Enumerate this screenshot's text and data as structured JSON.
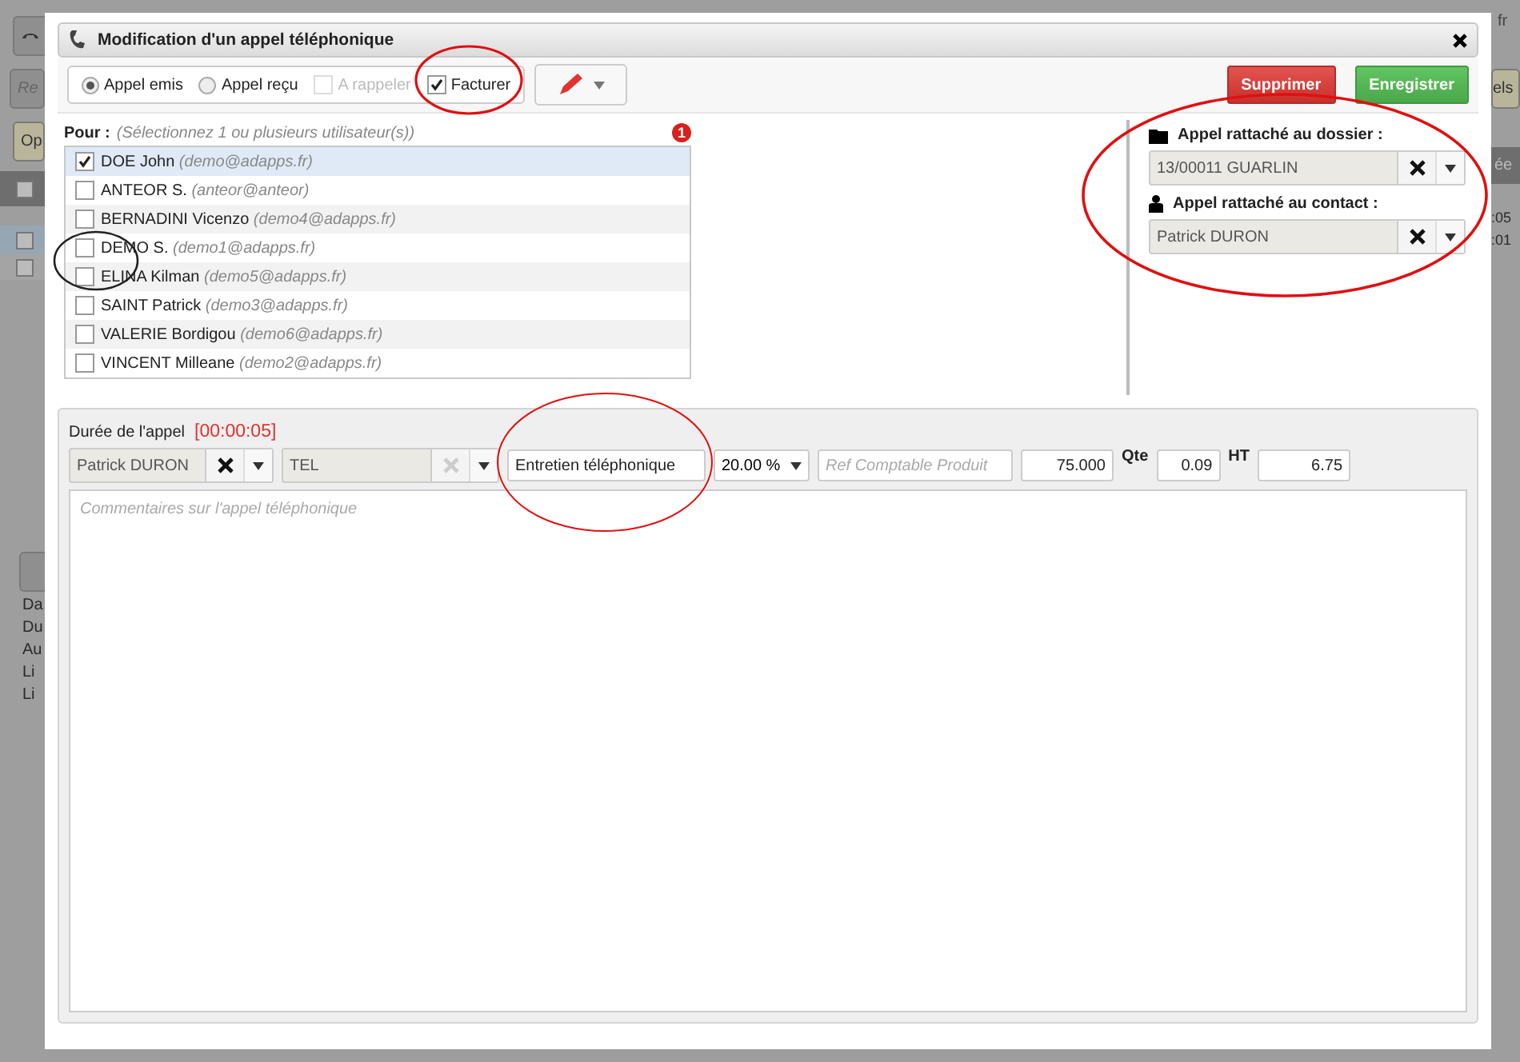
{
  "background": {
    "left": [
      {
        "kind": "button",
        "text": "Re"
      },
      {
        "kind": "tab",
        "text": "Op"
      },
      {
        "kind": "text",
        "text": "Da"
      },
      {
        "kind": "text",
        "text": "Du"
      },
      {
        "kind": "text",
        "text": "Au"
      },
      {
        "kind": "text",
        "text": "Li"
      },
      {
        "kind": "text",
        "text": "Li"
      }
    ],
    "right": [
      {
        "kind": "menu",
        "text": "fr"
      },
      {
        "kind": "button",
        "text": "els"
      },
      {
        "kind": "header",
        "text": "ée"
      },
      {
        "kind": "text",
        "text": ":05"
      },
      {
        "kind": "text",
        "text": ":01"
      }
    ]
  },
  "dialog": {
    "title": "Modification d'un appel téléphonique",
    "call_type": [
      {
        "label": "Appel emis",
        "selected": true
      },
      {
        "label": "Appel reçu",
        "selected": false
      }
    ],
    "options": [
      {
        "label": "A rappeler",
        "checked": false,
        "disabled": true
      },
      {
        "label": "Facturer",
        "checked": true,
        "disabled": false
      }
    ],
    "buttons": [
      {
        "label": "Supprimer",
        "kind": "danger"
      },
      {
        "label": "Enregistrer",
        "kind": "success"
      }
    ],
    "recipients": {
      "label": "Pour :",
      "hint": "(Sélectionnez 1 ou plusieurs utilisateur(s))",
      "badge": "1",
      "users": [
        {
          "name": "DOE John",
          "email": "(demo@adapps.fr)",
          "checked": true
        },
        {
          "name": "ANTEOR S.",
          "email": "(anteor@anteor)",
          "checked": false
        },
        {
          "name": "BERNADINI Vicenzo",
          "email": "(demo4@adapps.fr)",
          "checked": false
        },
        {
          "name": "DEMO S.",
          "email": "(demo1@adapps.fr)",
          "checked": false
        },
        {
          "name": "ELINA Kilman",
          "email": "(demo5@adapps.fr)",
          "checked": false
        },
        {
          "name": "SAINT Patrick",
          "email": "(demo3@adapps.fr)",
          "checked": false
        },
        {
          "name": "VALERIE Bordigou",
          "email": "(demo6@adapps.fr)",
          "checked": false
        },
        {
          "name": "VINCENT Milleane",
          "email": "(demo2@adapps.fr)",
          "checked": false
        }
      ]
    },
    "links": [
      {
        "kind": "folder",
        "label": "Appel rattaché au dossier :",
        "value": "13/00011 GUARLIN"
      },
      {
        "kind": "person",
        "label": "Appel rattaché au contact :",
        "value": "Patrick DURON"
      }
    ],
    "duration": {
      "label": "Durée de l'appel",
      "value": "[00:00:05]"
    },
    "line": {
      "contact": "Patrick DURON",
      "product": "TEL",
      "description": "Entretien téléphonique",
      "vat": "20.00 %",
      "ref_placeholder": "Ref Comptable Produit",
      "price": "75.000",
      "qty_label": "Qte",
      "qty": "0.09",
      "ht_label": "HT",
      "total": "6.75"
    },
    "comment_placeholder": "Commentaires sur l'appel téléphonique"
  },
  "annotations": [
    {
      "color": "#e01010"
    },
    {
      "color": "#e01010"
    },
    {
      "color": "#e01010"
    },
    {
      "color": "#222222"
    }
  ]
}
